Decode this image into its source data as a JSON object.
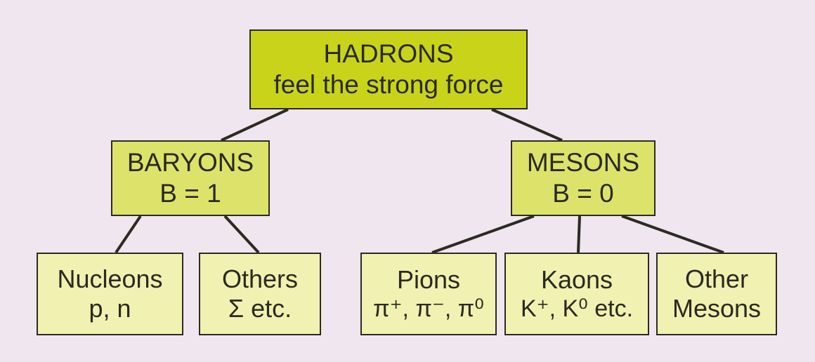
{
  "colors": {
    "background": "#f0e6ef",
    "root_fill": "#c9d31a",
    "mid_fill": "#dde36a",
    "leaf_fill": "#f1f1b2",
    "stroke": "#2b2b22"
  },
  "diagram": {
    "hadrons": {
      "title": "HADRONS",
      "subtitle": "feel the strong force"
    },
    "baryons": {
      "title": "BARYONS",
      "subtitle": "B = 1"
    },
    "mesons": {
      "title": "MESONS",
      "subtitle": "B = 0"
    },
    "nucleons": {
      "title": "Nucleons",
      "subtitle": "p, n"
    },
    "others": {
      "title": "Others",
      "subtitle": "Σ etc."
    },
    "pions": {
      "title": "Pions",
      "subtitle": "π⁺, π⁻, π⁰"
    },
    "kaons": {
      "title": "Kaons",
      "subtitle": "K⁺, K⁰ etc."
    },
    "other_mesons": {
      "title": "Other",
      "subtitle": "Mesons"
    }
  },
  "edges": [
    [
      "hadrons",
      "baryons"
    ],
    [
      "hadrons",
      "mesons"
    ],
    [
      "baryons",
      "nucleons"
    ],
    [
      "baryons",
      "others"
    ],
    [
      "mesons",
      "pions"
    ],
    [
      "mesons",
      "kaons"
    ],
    [
      "mesons",
      "other_mesons"
    ]
  ]
}
